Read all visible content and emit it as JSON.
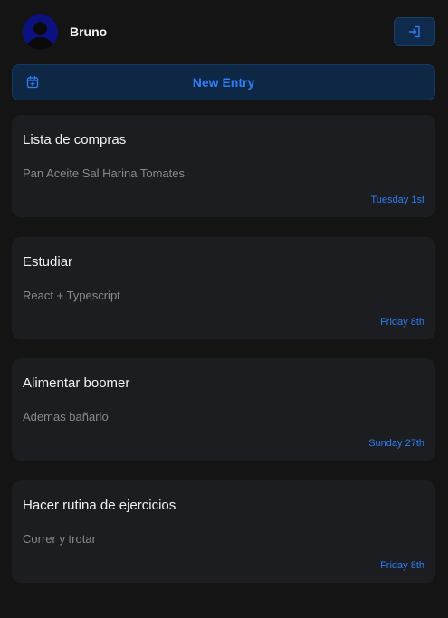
{
  "user": {
    "name": "Bruno"
  },
  "actions": {
    "new_entry_label": "New Entry"
  },
  "entries": [
    {
      "title": "Lista de compras",
      "description": "Pan Aceite Sal Harina Tomates",
      "date": "Tuesday 1st"
    },
    {
      "title": "Estudiar",
      "description": "React + Typescript",
      "date": "Friday 8th"
    },
    {
      "title": "Alimentar boomer",
      "description": "Ademas bañarlo",
      "date": "Sunday 27th"
    },
    {
      "title": "Hacer rutina de ejercicios",
      "description": "Correr y trotar",
      "date": "Friday 8th"
    }
  ],
  "colors": {
    "background": "#141414",
    "card": "#1c1d20",
    "accent": "#2f7df6",
    "button_bg": "#0e2745"
  },
  "icons": {
    "avatar": "user-avatar-icon",
    "logout": "logout-icon",
    "new_entry": "calendar-plus-icon"
  }
}
